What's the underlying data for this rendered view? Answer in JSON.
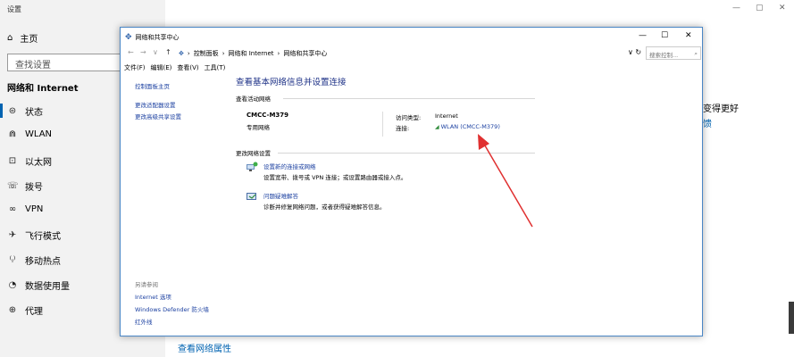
{
  "settings": {
    "title": "设置",
    "home": "主页",
    "search_placeholder": "查找设置",
    "section": "网络和 Internet",
    "nav": [
      {
        "icon": "⊜",
        "label": "状态"
      },
      {
        "icon": "⋒",
        "label": "WLAN"
      },
      {
        "icon": "⊡",
        "label": "以太网"
      },
      {
        "icon": "☏",
        "label": "拨号"
      },
      {
        "icon": "∞",
        "label": "VPN"
      },
      {
        "icon": "✈",
        "label": "飞行模式"
      },
      {
        "icon": "⁽ᵢ⁾",
        "label": "移动热点"
      },
      {
        "icon": "◔",
        "label": "数据使用量"
      },
      {
        "icon": "⊕",
        "label": "代理"
      }
    ],
    "right_text_1": "变得更好",
    "right_text_2": "馈",
    "network_props_link": "查看网络属性",
    "window_controls": {
      "minimize": "—",
      "maximize": "▢",
      "close": "✕"
    }
  },
  "control_panel": {
    "title": "网络和共享中心",
    "window_controls": {
      "minimize": "—",
      "maximize": "☐",
      "close": "✕"
    },
    "address": {
      "back": "←",
      "forward": "→",
      "recent": "∨",
      "up": "↑",
      "crumbs": [
        "控制面板",
        "网络和 Internet",
        "网络和共享中心"
      ],
      "separator": "›",
      "dropdown": "∨",
      "refresh": "↻"
    },
    "search_placeholder": "搜索控制...",
    "menu": [
      "文件(F)",
      "编辑(E)",
      "查看(V)",
      "工具(T)"
    ],
    "left_links": [
      "控制面板主页",
      "更改适配器设置",
      "更改高级共享设置"
    ],
    "see_also_label": "另请参阅",
    "see_also_links": [
      "Internet 选项",
      "Windows Defender 防火墙",
      "红外线"
    ],
    "main_title": "查看基本网络信息并设置连接",
    "active_networks_label": "查看活动网络",
    "network": {
      "name": "CMCC-M379",
      "type": "专用网络",
      "access_type_key": "访问类型:",
      "access_type_val": "Internet",
      "connection_key": "连接:",
      "connection_val": "WLAN (CMCC-M379)"
    },
    "change_settings_label": "更改网络设置",
    "tasks": [
      {
        "title": "设置新的连接或网络",
        "desc": "设置宽带、拨号或 VPN 连接；或设置路由器或接入点。"
      },
      {
        "title": "问题疑难解答",
        "desc": "诊断并修复网络问题，或者获得疑难解答信息。"
      }
    ]
  },
  "annotation": {
    "color": "#e03030"
  }
}
